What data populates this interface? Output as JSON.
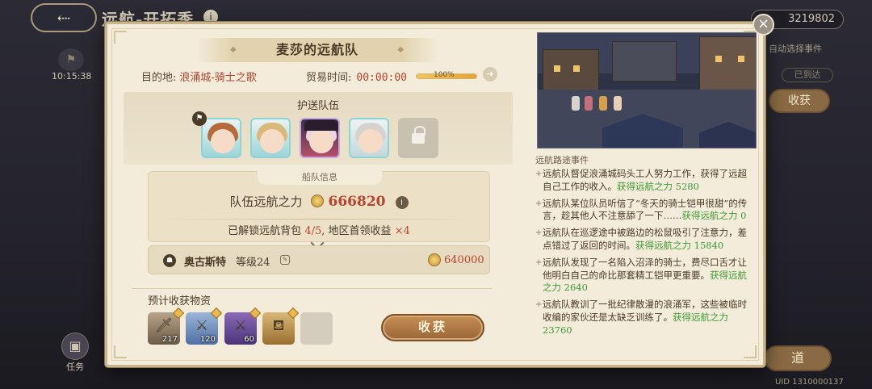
{
  "background": {
    "screen_title": "远航-开拓季",
    "currency": "3219802",
    "timer": "10:15:38",
    "auto_select": "自动选择事件",
    "arrived_badge": "已到达",
    "collect_label": "收获",
    "task_label": "任务",
    "road_button": "道",
    "uid": "UID 1310000137"
  },
  "dialog": {
    "title": "麦莎的远航队",
    "destination_label": "目的地:",
    "destination": "浪涌城-骑士之歌",
    "trade_time_label": "贸易时间:",
    "trade_time": "00:00:00",
    "progress_percent": 100,
    "progress_text": "100%",
    "escort_title": "护送队伍",
    "escort_members": [
      "hero-1",
      "hero-2",
      "hero-3",
      "hero-4"
    ],
    "escort_locked_slots": 1,
    "fleet": {
      "tab_label": "船队信息",
      "power_label": "队伍远航之力",
      "power_value": "666820",
      "unlock_label": "已解锁远航背包",
      "unlock_value": "4/5",
      "separator": ",",
      "first_claim_label": "地区首领收益",
      "first_claim_value": "×4"
    },
    "captain": {
      "name": "奥古斯特",
      "level": "等级24",
      "power": "640000"
    },
    "expected_title": "预计收获物资",
    "items": [
      {
        "icon": "sword-icon",
        "count": "217"
      },
      {
        "icon": "blade-icon",
        "count": "120"
      },
      {
        "icon": "magic-blade-icon",
        "count": "60"
      },
      {
        "icon": "lantern-icon",
        "count": ""
      },
      {
        "icon": "empty-slot",
        "count": ""
      }
    ],
    "collect_button": "收获",
    "events_title": "远航路途事件",
    "events": [
      {
        "text": "远航队督促浪涌城码头工人努力工作，获得了远超自己工作的收入。",
        "reward": "获得远航之力 5280"
      },
      {
        "text": "远航队某位队员听信了“冬天的骑士铠甲很甜”的传言，趁其他人不注意舔了一下……",
        "reward": "获得远航之力 0"
      },
      {
        "text": "远航队在巡逻途中被路边的松鼠吸引了注意力，差点错过了返回的时间。",
        "reward": "获得远航之力 15840"
      },
      {
        "text": "远航队发现了一名陷入沼泽的骑士，费尽口舌才让他明白自己的命比那套精工铠甲更重要。",
        "reward": "获得远航之力 2640"
      },
      {
        "text": "远航队教训了一批纪律散漫的浪涌军，这些被临时收编的家伙还是太缺乏训练了。",
        "reward": "获得远航之力 23760"
      }
    ]
  }
}
